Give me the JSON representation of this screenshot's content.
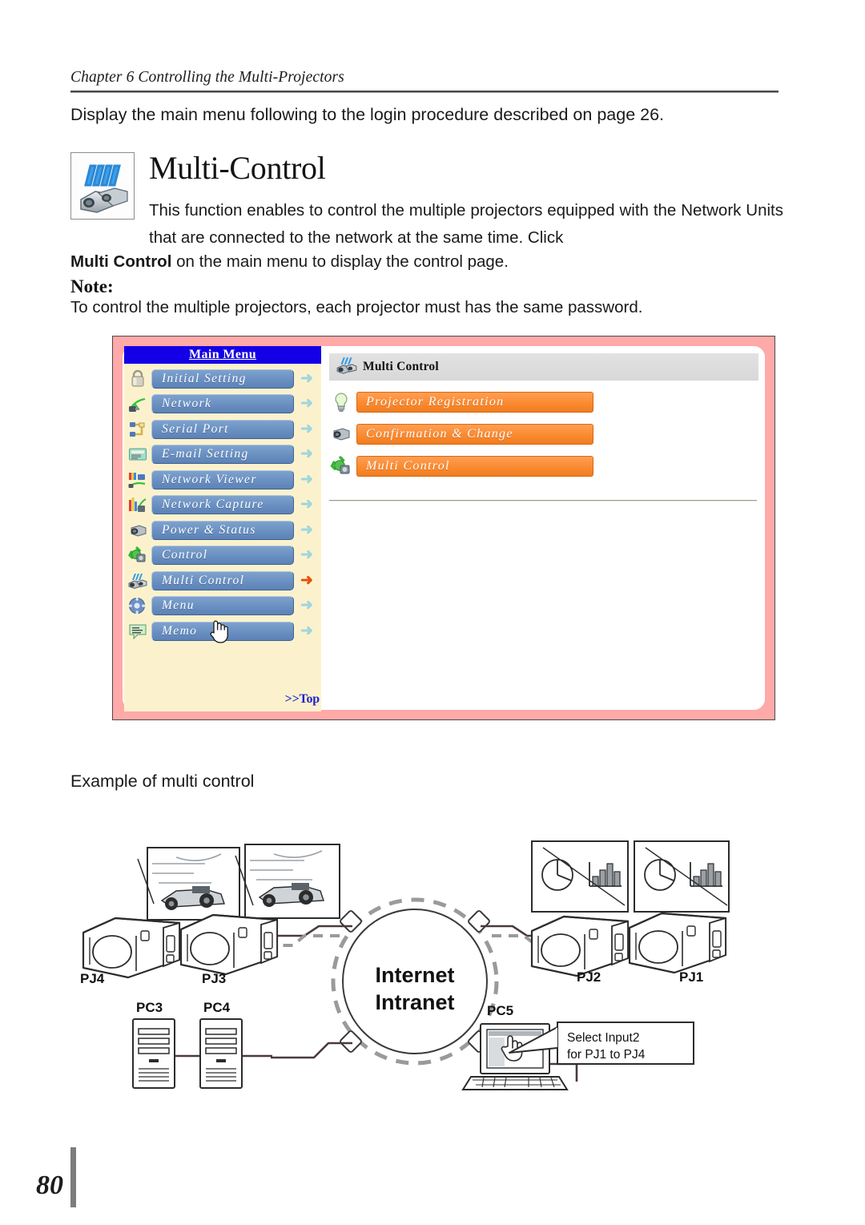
{
  "header": {
    "chapter": "Chapter 6 Controlling the Multi-Projectors"
  },
  "intro": {
    "line": "Display the main menu following to the login procedure described on page 26."
  },
  "title": {
    "heading": "Multi-Control",
    "icon": "multi-projector-icon"
  },
  "body": {
    "paragraph": "This function enables to control the multiple projectors equipped with the Network Units that are connected to the network at the same time. Click",
    "paragraph_cont_bold": "Multi Control",
    "paragraph_cont_rest": " on the main menu to display the control page.",
    "note_label": "Note:",
    "note_text": "To control the multiple projectors, each projector must has the same password."
  },
  "screenshot": {
    "nav": {
      "title": "Main Menu",
      "top_link": ">>Top",
      "items": [
        {
          "label": "Initial Setting",
          "icon": "padlock-icon",
          "arrow": "cyan"
        },
        {
          "label": "Network",
          "icon": "network-plug-icon",
          "arrow": "cyan"
        },
        {
          "label": "Serial Port",
          "icon": "serial-port-icon",
          "arrow": "cyan"
        },
        {
          "label": "E-mail Setting",
          "icon": "email-icon",
          "arrow": "cyan"
        },
        {
          "label": "Network Viewer",
          "icon": "network-viewer-icon",
          "arrow": "cyan"
        },
        {
          "label": "Network Capture",
          "icon": "network-capture-icon",
          "arrow": "cyan"
        },
        {
          "label": "Power & Status",
          "icon": "projector-icon",
          "arrow": "cyan"
        },
        {
          "label": "Control",
          "icon": "control-gear-icon",
          "arrow": "cyan"
        },
        {
          "label": "Multi Control",
          "icon": "multi-projector-icon",
          "arrow": "orange"
        },
        {
          "label": "Menu",
          "icon": "menu-wheel-icon",
          "arrow": "cyan"
        },
        {
          "label": "Memo",
          "icon": "memo-balloon-icon",
          "arrow": "cyan"
        }
      ]
    },
    "content": {
      "header_title": "Multi Control",
      "header_icon": "multi-projector-icon",
      "buttons": [
        {
          "label": "Projector Registration",
          "icon": "bulb-icon"
        },
        {
          "label": "Confirmation & Change",
          "icon": "camera-icon"
        },
        {
          "label": "Multi Control",
          "icon": "control-gear-icon"
        }
      ]
    },
    "colors": {
      "frame": "#ffa9a9",
      "nav_background": "#fbf2cd",
      "nav_title_background": "#1400e6",
      "nav_button": "#6d93c4",
      "content_button": "#fb8c33",
      "active_arrow": "#e8520b",
      "inactive_arrow": "#9fd6dd",
      "top_link": "#2222cc"
    }
  },
  "example": {
    "caption": "Example of multi control",
    "cloud": {
      "line1": "Internet",
      "line2": "Intranet"
    },
    "projectors": [
      {
        "id": "PJ4",
        "screen": "racing-car-image"
      },
      {
        "id": "PJ3",
        "screen": "racing-car-image"
      },
      {
        "id": "PJ2",
        "screen": "chart-image"
      },
      {
        "id": "PJ1",
        "screen": "chart-image"
      }
    ],
    "computers": [
      {
        "id": "PC3",
        "type": "desktop-tower"
      },
      {
        "id": "PC4",
        "type": "desktop-tower"
      },
      {
        "id": "PC5",
        "type": "laptop"
      }
    ],
    "callout": {
      "line1": "Select Input2",
      "line2": "for PJ1 to PJ4"
    }
  },
  "footer": {
    "page_number": "80"
  }
}
